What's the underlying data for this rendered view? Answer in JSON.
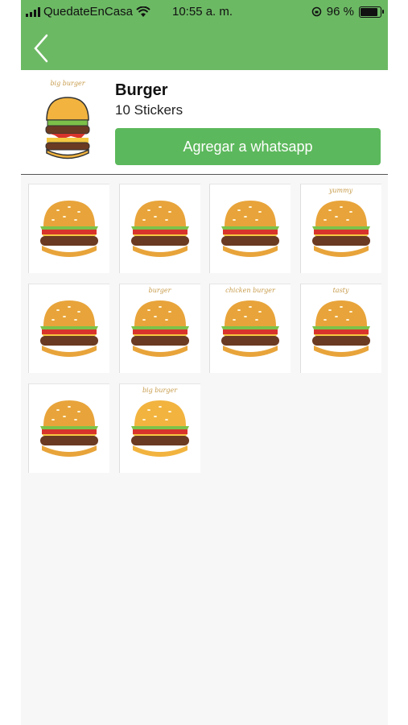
{
  "status": {
    "carrier": "QuedateEnCasa",
    "time": "10:55 a. m.",
    "battery": "96 %"
  },
  "nav": {
    "back_icon": "chevron-left-icon"
  },
  "pack": {
    "title": "Burger",
    "count": "10 Stickers",
    "thumb_caption": "big burger",
    "add_button": "Agregar a whatsapp"
  },
  "stickers": [
    {
      "name": "bacon-burger",
      "caption": ""
    },
    {
      "name": "classic-burger",
      "caption": ""
    },
    {
      "name": "cheeseburger",
      "caption": ""
    },
    {
      "name": "yummy-burger",
      "caption": "yummy"
    },
    {
      "name": "ham-burger",
      "caption": ""
    },
    {
      "name": "double-burger",
      "caption": "burger"
    },
    {
      "name": "chicken-burger",
      "caption": "chicken burger"
    },
    {
      "name": "tasty-burger",
      "caption": "tasty"
    },
    {
      "name": "deluxe-burger",
      "caption": ""
    },
    {
      "name": "big-burger",
      "caption": "big burger"
    }
  ],
  "colors": {
    "header": "#6cb964",
    "button": "#5cb85c",
    "bun": "#e8a43a",
    "patty": "#6b3a22",
    "lettuce": "#7cc24a",
    "cheese": "#f5c842",
    "tomato": "#d8342c"
  }
}
